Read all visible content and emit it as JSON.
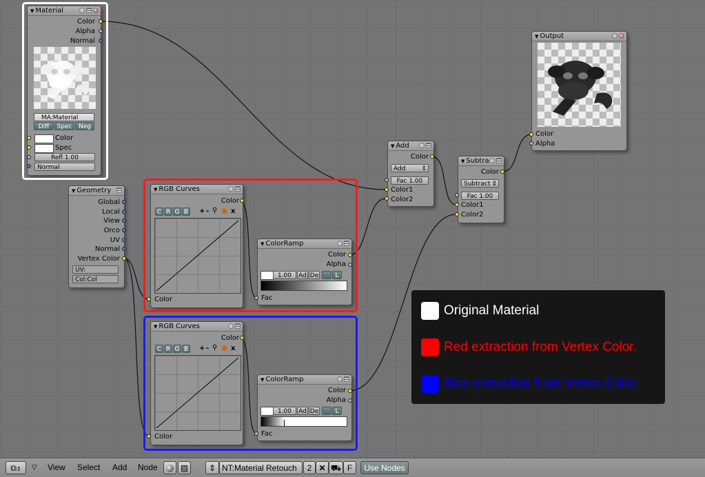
{
  "material_node": {
    "title": "Material",
    "out_color": "Color",
    "out_alpha": "Alpha",
    "out_normal": "Normal",
    "material_field": "MA:Material",
    "toggle_diff": "Diff",
    "toggle_spec": "Spec",
    "toggle_neg": "Neg",
    "in_color": "Color",
    "in_spec": "Spec",
    "refl": "Refl 1.00",
    "normal": "Normal"
  },
  "output_node": {
    "title": "Output",
    "in_color": "Color",
    "in_alpha": "Alpha"
  },
  "geometry_node": {
    "title": "Geometry",
    "outputs": [
      "Global",
      "Local",
      "View",
      "Orco",
      "UV",
      "Normal",
      "Vertex Color"
    ],
    "uv_field": "UV:",
    "col_field": "Col:Col"
  },
  "rgb_curves_top": {
    "title": "RGB Curves",
    "buttons": [
      "C",
      "R",
      "G",
      "B"
    ],
    "tools": [
      "+",
      "-",
      "x"
    ],
    "out_color": "Color",
    "in_color": "Color"
  },
  "rgb_curves_bottom": {
    "title": "RGB Curves",
    "buttons": [
      "C",
      "R",
      "G",
      "B"
    ],
    "tools": [
      "+",
      "-",
      "x"
    ],
    "out_color": "Color",
    "in_color": "Color"
  },
  "color_ramp_top": {
    "title": "ColorRamp",
    "out_color": "Color",
    "out_alpha": "Alpha",
    "pos": "1.00",
    "add": "Ad",
    "del": "De",
    "l": "L",
    "in_fac": "Fac"
  },
  "color_ramp_bottom": {
    "title": "ColorRamp",
    "out_color": "Color",
    "out_alpha": "Alpha",
    "pos": "1.00",
    "add": "Ad",
    "del": "De",
    "l": "L",
    "in_fac": "Fac"
  },
  "add_node": {
    "title": "Add",
    "out_color": "Color",
    "mode": "Add",
    "fac": "Fac 1.00",
    "in_color1": "Color1",
    "in_color2": "Color2"
  },
  "subtract_node": {
    "title": "Subtra",
    "out_color": "Color",
    "mode": "Subtract",
    "fac": "Fac 1.00",
    "in_color1": "Color1",
    "in_color2": "Color2"
  },
  "legend": {
    "items": [
      {
        "label": "Original Material",
        "color": "#ffffff"
      },
      {
        "label": "Red extraction from Vertex Color.",
        "color": "#ff0000"
      },
      {
        "label": "Blue extraction from Vertex Color.",
        "color": "#0000ff"
      }
    ]
  },
  "colors": {
    "red_frame": "#ff1a1a",
    "blue_frame": "#1a1aff",
    "white_frame": "#ffffff"
  },
  "bottom_bar": {
    "menus": [
      "View",
      "Select",
      "Add",
      "Node"
    ],
    "tree_name": "NT:Material Retouch",
    "users": "2",
    "fake_user": "F",
    "use_nodes": "Use Nodes"
  }
}
